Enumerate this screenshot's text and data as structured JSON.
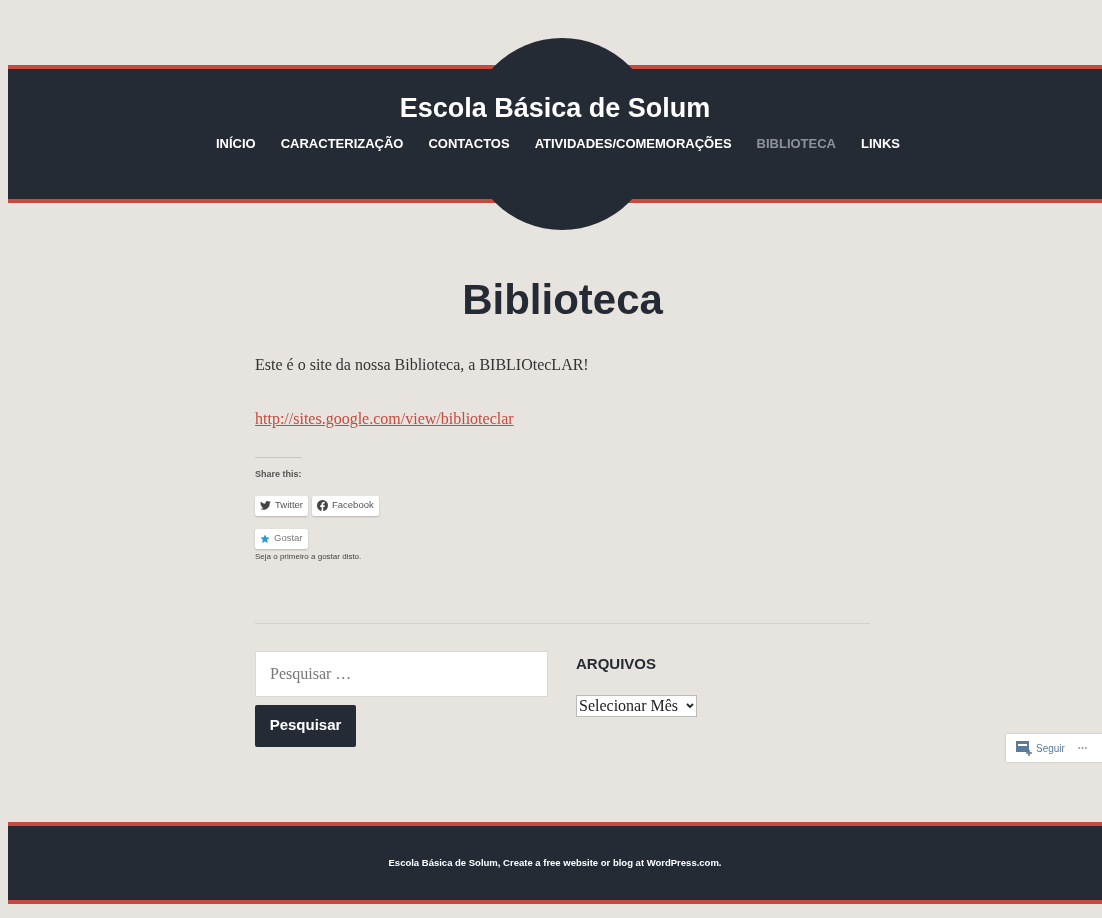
{
  "site_title": "Escola Básica de Solum",
  "nav": [
    {
      "label": "INÍCIO",
      "selected": false
    },
    {
      "label": "CARACTERIZAÇÃO",
      "selected": false
    },
    {
      "label": "CONTACTOS",
      "selected": false
    },
    {
      "label": "ATIVIDADES/COMEMORAÇÕES",
      "selected": false
    },
    {
      "label": "BIBLIOTECA",
      "selected": true
    },
    {
      "label": "LINKS",
      "selected": false
    }
  ],
  "page": {
    "title": "Biblioteca",
    "paragraph": "Este é o site da nossa Biblioteca, a BIBLIOtecLAR!",
    "link": "http://sites.google.com/view/biblioteclar"
  },
  "share": {
    "heading": "Share this:",
    "buttons": [
      {
        "kind": "twitter",
        "label": "Twitter"
      },
      {
        "kind": "facebook",
        "label": "Facebook"
      }
    ]
  },
  "like": {
    "button": "Gostar",
    "note": "Seja o primeiro a gostar disto."
  },
  "search": {
    "placeholder": "Pesquisar …",
    "button": "Pesquisar"
  },
  "archives": {
    "heading": "ARQUIVOS",
    "select": "Selecionar Mês"
  },
  "follow": {
    "label": "Seguir",
    "more": "•••"
  },
  "footer": "Escola Básica de Solum, Create a free website or blog at WordPress.com."
}
